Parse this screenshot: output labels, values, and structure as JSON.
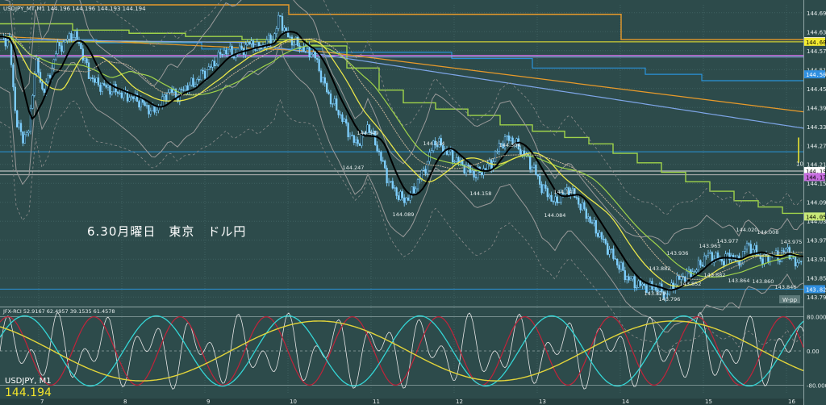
{
  "header": {
    "main_title": "USDJPY_MT,M1  144.196 144.196 144.193 144.194",
    "osc_title": "JFX-RCI 52.9167 62.4957 39.1535 61.4578"
  },
  "overlay_text": "6.30月曜日　東京　ドル円",
  "bottom_symbol": "USDJPY, M1",
  "bottom_price": "144.194",
  "wpp_label": "W-pp",
  "vertical_marker_label": "10",
  "colors": {
    "background": "#2d4b4b",
    "grid": "#3f6161",
    "candle": "#7fd0ff",
    "ma_black": "#000000",
    "ma_yellow": "#e9e64a",
    "ma_green": "#9fd34a",
    "ma_blue": "#7ea6e8",
    "ma_orange": "#e89a2a",
    "band": "#9a9a9a",
    "rci_white": "#e6e6e6",
    "rci_cyan": "#34d6d6",
    "rci_red": "#c2233a",
    "rci_yellow": "#e2d43a"
  },
  "chart_data": {
    "type": "line",
    "title": "USDJPY_MT,M1",
    "price_axis": {
      "labels": [
        "144.695",
        "144.635",
        "144.575",
        "144.515",
        "144.455",
        "144.395",
        "144.335",
        "144.275",
        "144.215",
        "144.155",
        "144.095",
        "144.035",
        "143.975",
        "143.915",
        "143.855",
        "143.795"
      ],
      "ylim": [
        143.77,
        144.72
      ]
    },
    "highlighted_prices": [
      {
        "value": 144.605,
        "label": "144.605",
        "color": "#eeeeee",
        "text_color": "#000000"
      },
      {
        "value": 144.603,
        "label": "144.603",
        "color": "#f4ec30",
        "text_color": "#000000"
      },
      {
        "value": 144.5,
        "label": "144.500",
        "color": "#2f8fe0",
        "text_color": "#ffffff"
      },
      {
        "value": 144.194,
        "label": "144.194",
        "color": "#ffffff",
        "text_color": "#000000"
      },
      {
        "value": 144.175,
        "label": "144.175",
        "color": "#c86ee0",
        "text_color": "#000000"
      },
      {
        "value": 144.05,
        "label": "144.050",
        "color": "#c8e878",
        "text_color": "#000000"
      },
      {
        "value": 143.82,
        "label": "143.820",
        "color": "#2f8fe0",
        "text_color": "#ffffff"
      }
    ],
    "x_tick_labels": [
      "7",
      "8",
      "9",
      "10",
      "11",
      "12",
      "13",
      "14",
      "15",
      "16"
    ],
    "annotations": [
      {
        "label": "144.349",
        "x": 456,
        "y": 167
      },
      {
        "label": "144.247",
        "x": 438,
        "y": 210
      },
      {
        "label": "144.089",
        "x": 500,
        "y": 268
      },
      {
        "label": "144.314",
        "x": 538,
        "y": 180
      },
      {
        "label": "144.158",
        "x": 596,
        "y": 242
      },
      {
        "label": "144.304",
        "x": 632,
        "y": 182
      },
      {
        "label": "144.084",
        "x": 688,
        "y": 269
      },
      {
        "label": "144.147",
        "x": 700,
        "y": 240
      },
      {
        "label": "143.936",
        "x": 840,
        "y": 316
      },
      {
        "label": "143.882",
        "x": 818,
        "y": 335
      },
      {
        "label": "143.852",
        "x": 856,
        "y": 354
      },
      {
        "label": "143.829",
        "x": 812,
        "y": 366
      },
      {
        "label": "143.796",
        "x": 830,
        "y": 373
      },
      {
        "label": "143.963",
        "x": 880,
        "y": 307
      },
      {
        "label": "143.977",
        "x": 902,
        "y": 301
      },
      {
        "label": "143.882",
        "x": 886,
        "y": 343
      },
      {
        "label": "143.864",
        "x": 916,
        "y": 350
      },
      {
        "label": "144.020",
        "x": 926,
        "y": 287
      },
      {
        "label": "144.008",
        "x": 952,
        "y": 290
      },
      {
        "label": "143.975",
        "x": 981,
        "y": 302
      },
      {
        "label": "143.860",
        "x": 946,
        "y": 351
      },
      {
        "label": "143.846",
        "x": 974,
        "y": 358
      }
    ],
    "oscillator": {
      "levels": [
        "80.0000",
        "0.00",
        "-80.0000"
      ],
      "ylim": [
        -100,
        100
      ]
    }
  }
}
